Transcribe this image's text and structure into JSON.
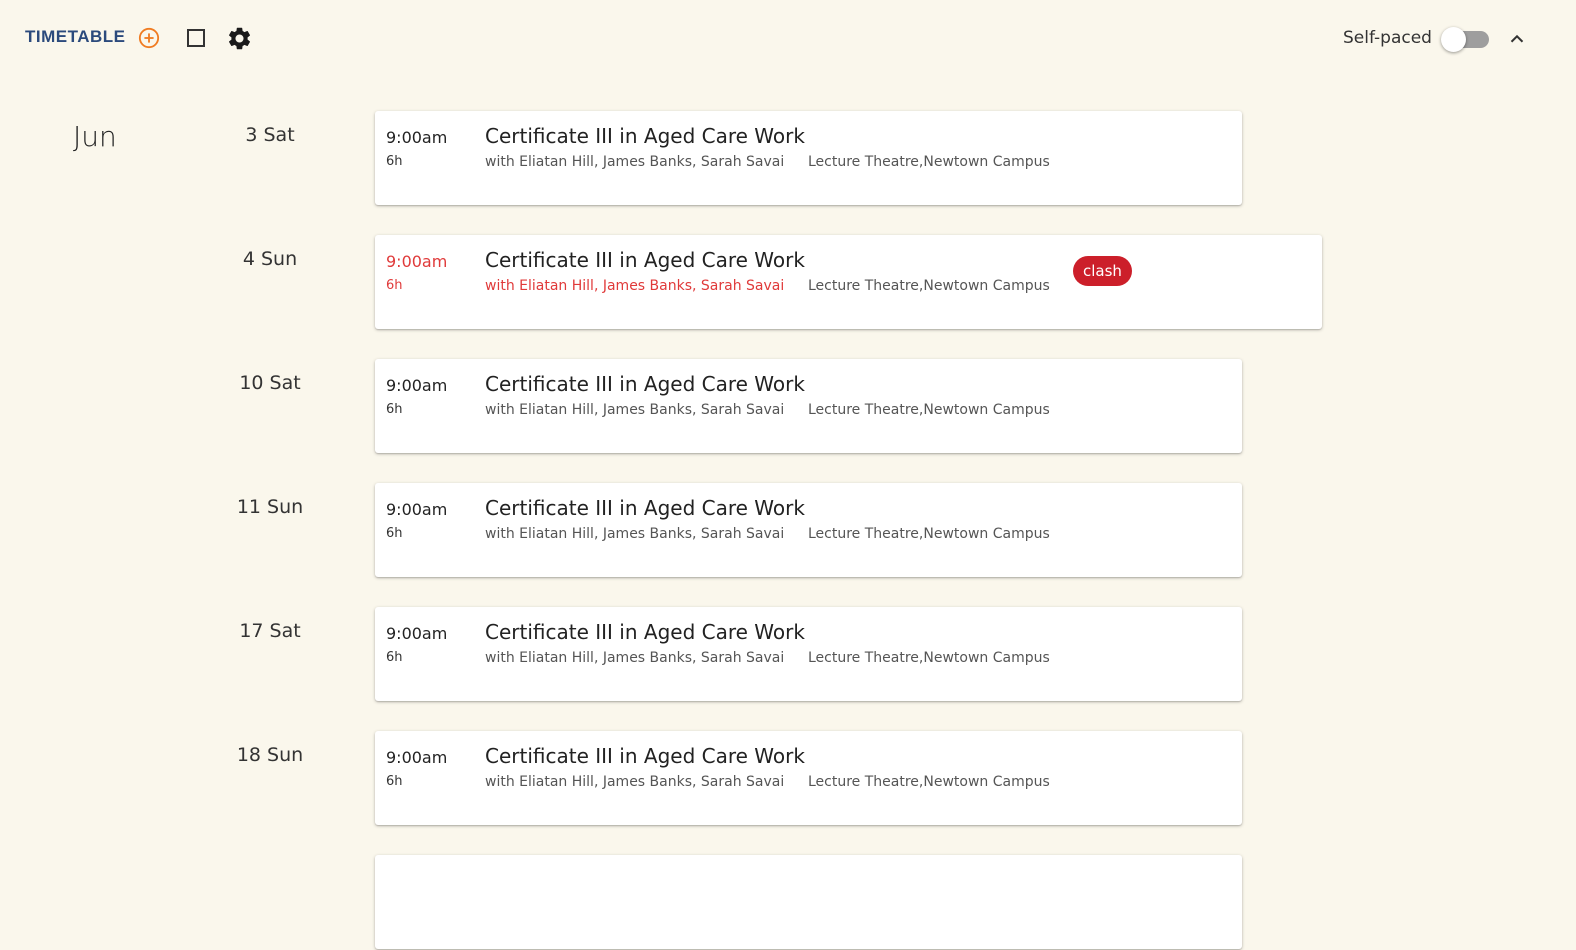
{
  "header": {
    "title": "TIMETABLE",
    "self_paced_label": "Self-paced",
    "self_paced_on": false,
    "icons": [
      "add-circle-icon",
      "checkbox-icon",
      "gear-icon",
      "chevron-up-icon"
    ],
    "accent_color": "#f07c22",
    "title_color": "#2b4a7c"
  },
  "timetable": {
    "month": "Jun",
    "sessions": [
      {
        "day": "3 Sat",
        "time": "9:00am",
        "duration": "6h",
        "course": "Certificate III in Aged Care Work",
        "tutors": "with Eliatan Hill, James Banks, Sarah Savai",
        "location": "Lecture Theatre,Newtown Campus",
        "clash": false
      },
      {
        "day": "4 Sun",
        "time": "9:00am",
        "duration": "6h",
        "course": "Certificate III in Aged Care Work",
        "tutors": "with Eliatan Hill, James Banks, Sarah Savai",
        "location": "Lecture Theatre,Newtown Campus",
        "clash": true,
        "badge": "clash"
      },
      {
        "day": "10 Sat",
        "time": "9:00am",
        "duration": "6h",
        "course": "Certificate III in Aged Care Work",
        "tutors": "with Eliatan Hill, James Banks, Sarah Savai",
        "location": "Lecture Theatre,Newtown Campus",
        "clash": false
      },
      {
        "day": "11 Sun",
        "time": "9:00am",
        "duration": "6h",
        "course": "Certificate III in Aged Care Work",
        "tutors": "with Eliatan Hill, James Banks, Sarah Savai",
        "location": "Lecture Theatre,Newtown Campus",
        "clash": false
      },
      {
        "day": "17 Sat",
        "time": "9:00am",
        "duration": "6h",
        "course": "Certificate III in Aged Care Work",
        "tutors": "with Eliatan Hill, James Banks, Sarah Savai",
        "location": "Lecture Theatre,Newtown Campus",
        "clash": false
      },
      {
        "day": "18 Sun",
        "time": "9:00am",
        "duration": "6h",
        "course": "Certificate III in Aged Care Work",
        "tutors": "with Eliatan Hill, James Banks, Sarah Savai",
        "location": "Lecture Theatre,Newtown Campus",
        "clash": false
      }
    ]
  }
}
